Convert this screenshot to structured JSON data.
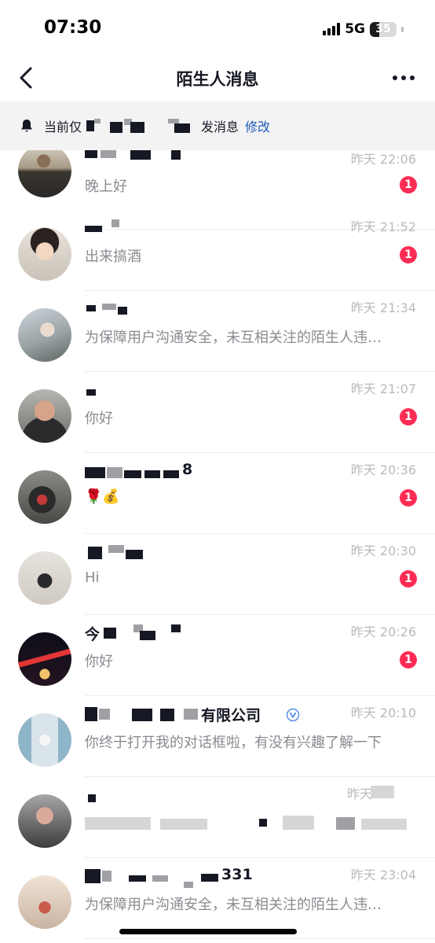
{
  "status_bar": {
    "time": "07:30",
    "network": "5G",
    "battery_level": "35",
    "battery_fraction": 0.35
  },
  "nav": {
    "title": "陌生人消息",
    "back_icon": "chevron-left-icon",
    "more_icon": "more-horizontal-icon"
  },
  "notice": {
    "icon": "bell-icon",
    "text_before": "当前仅",
    "text_after": "发消息",
    "action_label": "修改",
    "action_color": "#1d5bb8"
  },
  "colors": {
    "badge": "#fe2c55",
    "name": "#161823",
    "preview": "#8a8b91",
    "time": "#b9babd",
    "notice_bg": "#f3f3f4"
  },
  "messages": [
    {
      "name": "",
      "time": "昨天 22:06",
      "preview": "晚上好",
      "unread": "1"
    },
    {
      "name": "",
      "time": "昨天 21:52",
      "preview": "出来搞酒",
      "unread": "1"
    },
    {
      "name": "",
      "time": "昨天 21:34",
      "preview": "为保障用户沟通安全，未互相关注的陌生人违…",
      "unread": ""
    },
    {
      "name": "",
      "time": "昨天 21:07",
      "preview": "你好",
      "unread": "1"
    },
    {
      "name": "8",
      "time": "昨天 20:36",
      "preview": "🌹💰",
      "unread": "1"
    },
    {
      "name": "",
      "time": "昨天 20:30",
      "preview": "Hi",
      "unread": "1"
    },
    {
      "name": "今",
      "time": "昨天 20:26",
      "preview": "你好",
      "unread": "1"
    },
    {
      "name": "有限公司",
      "time": "昨天 20:10",
      "preview": "你终于打开我的对话框啦，有没有兴趣了解一下",
      "unread": "",
      "verified_icon": "verified-badge-icon"
    },
    {
      "name": "",
      "time": "昨天",
      "preview": "",
      "unread": ""
    },
    {
      "name": "331",
      "time": "昨天 23:04",
      "preview": "为保障用户沟通安全，未互相关注的陌生人违…",
      "unread": ""
    }
  ]
}
